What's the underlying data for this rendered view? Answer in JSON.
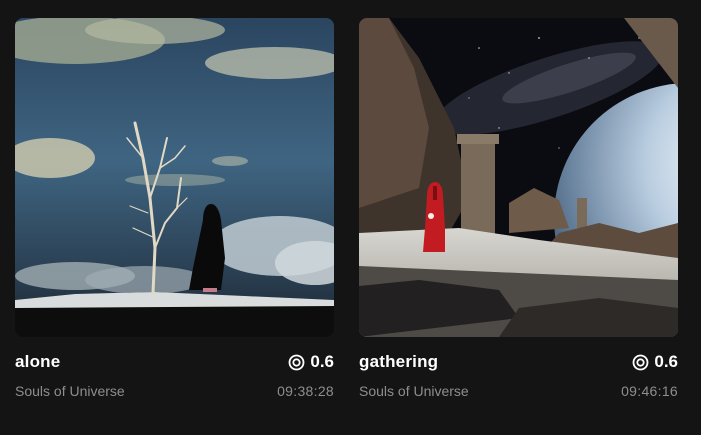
{
  "cards": [
    {
      "title": "alone",
      "price": "0.6",
      "price_icon": "currency-coin-icon",
      "creator": "Souls of Universe",
      "time_left": "09:38:28",
      "artwork": "lone-figure-on-cliff-with-dead-tree-above-clouds"
    },
    {
      "title": "gathering",
      "price": "0.6",
      "price_icon": "currency-coin-icon",
      "creator": "Souls of Universe",
      "time_left": "09:46:16",
      "artwork": "red-robed-figure-on-moon-surface-with-planet-and-pillar"
    }
  ],
  "colors": {
    "background": "#141414",
    "title_text": "#ffffff",
    "secondary_text": "#8e8e8e"
  }
}
